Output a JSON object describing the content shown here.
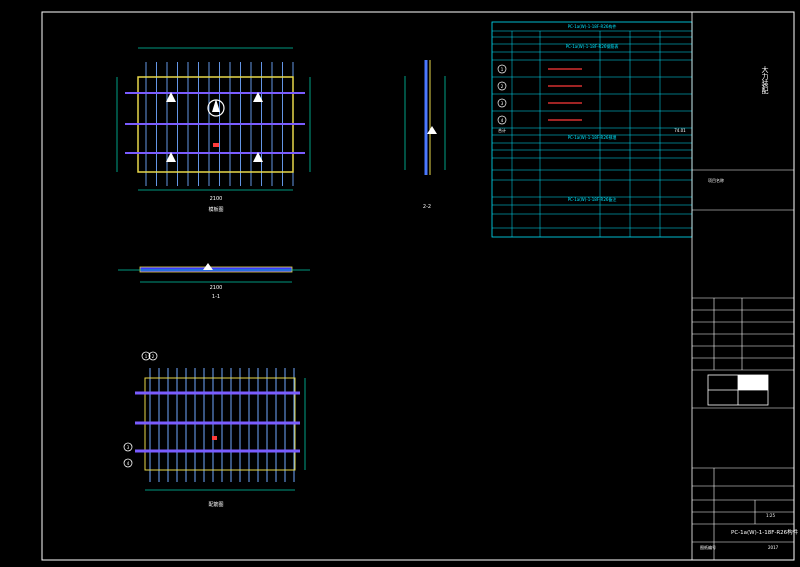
{
  "colors": {
    "background": "#000000",
    "frame": "#ffffff",
    "slab": "#e8d84a",
    "rebar": "#4a78ff",
    "rebar_bar": "#7a5cff",
    "table": "#00e5ff",
    "marker": "#ff3b3b",
    "dim": "#00c8a8"
  },
  "plan_view": {
    "width_dim": "2100",
    "caption": "模板图"
  },
  "section_2": {
    "caption": "2-2"
  },
  "section_1": {
    "width_dim": "2100",
    "caption": "1-1"
  },
  "rebar_view": {
    "caption": "配筋图",
    "markers": [
      "1",
      "2",
      "3",
      "4"
    ]
  },
  "table": {
    "title_1": "PC-1a(W)-1-18F-R26构件",
    "title_2": "PC-1a(W)-1-18F-R26钢筋表",
    "title_3": "PC-1a(W)-1-18F-R26预埋",
    "title_4": "PC-1a(W)-1-18F-R26备注",
    "rows_num": [
      "1",
      "2",
      "3",
      "4"
    ],
    "total_label": "合计",
    "total_value": "74.01"
  },
  "title_block": {
    "company": "大力装配",
    "project_label": "项目名称",
    "drawing_no": "PC-1a(W)-1-18F-R26构件",
    "scale": "1:25",
    "page": "2017",
    "footer_label": "图纸编号"
  }
}
